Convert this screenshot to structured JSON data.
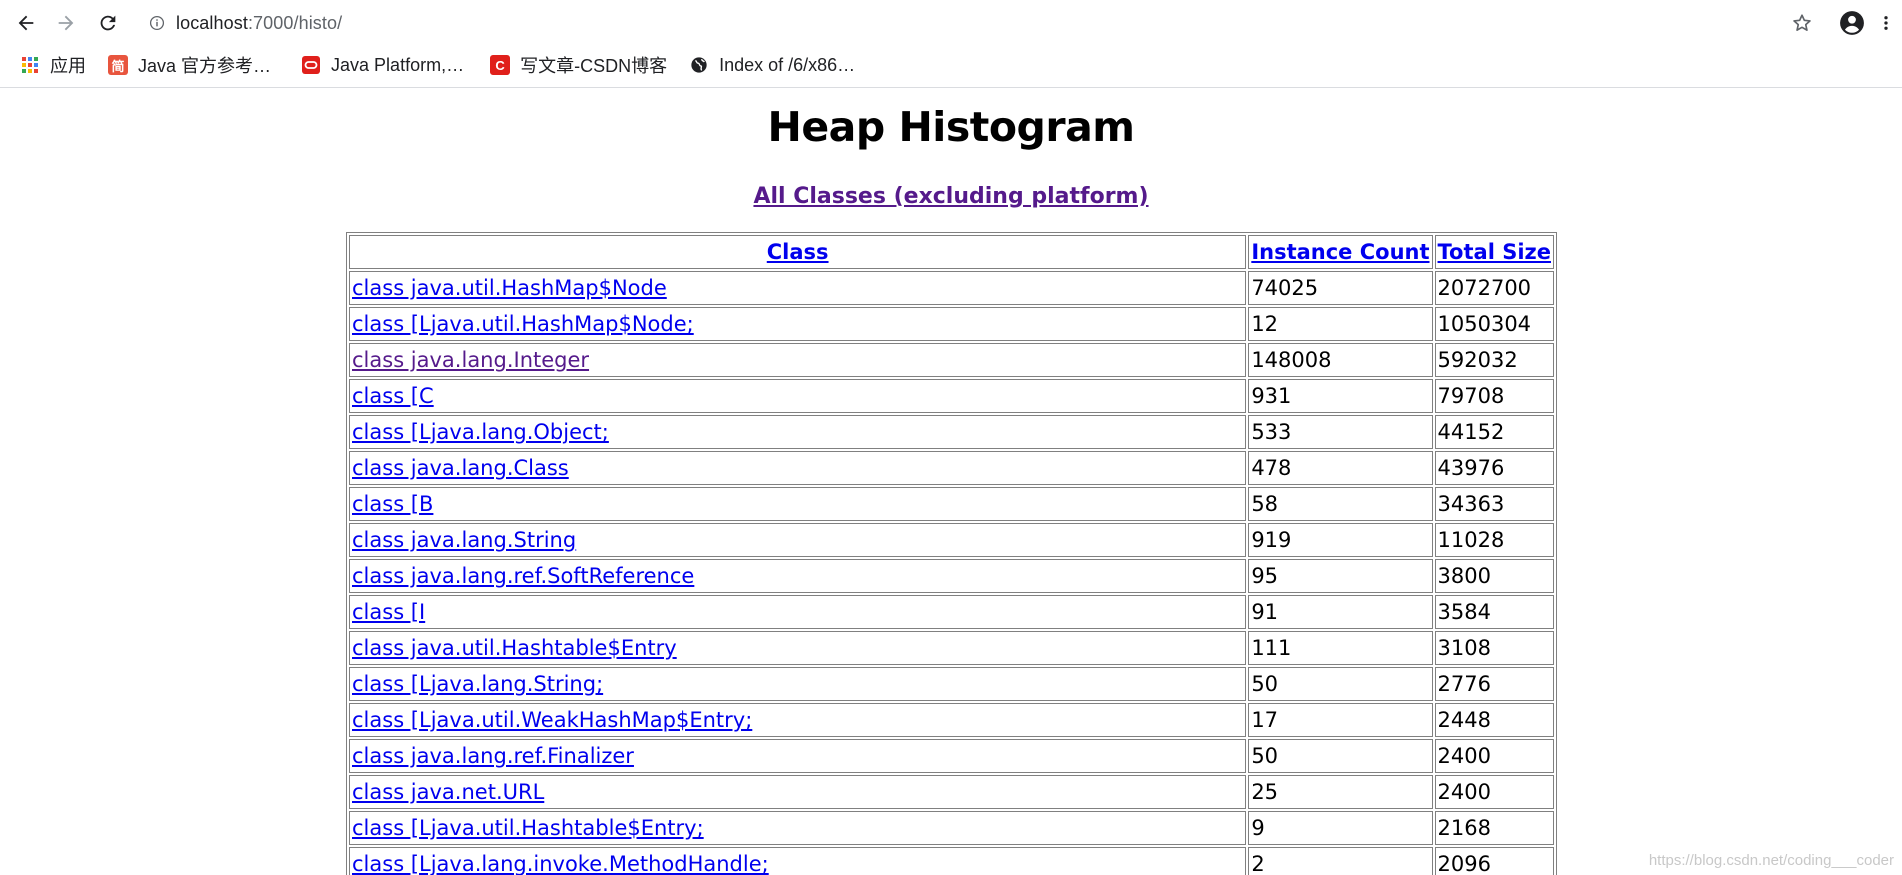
{
  "browser": {
    "url_host": "localhost",
    "url_path": ":7000/histo/",
    "bookmarks": [
      {
        "label": "应用",
        "icon": "apps-grid-icon"
      },
      {
        "label": "Java 官方参考…",
        "icon": "jian-favicon-icon",
        "color": "#e8553e",
        "glyph": "简"
      },
      {
        "label": "Java Platform,…",
        "icon": "oracle-favicon-icon",
        "color": "#e0201b"
      },
      {
        "label": "写文章-CSDN博客",
        "icon": "csdn-favicon-icon",
        "color": "#e0201b",
        "glyph": "C"
      },
      {
        "label": "Index of /6/x86…",
        "icon": "globe-icon"
      }
    ]
  },
  "page": {
    "title": "Heap Histogram",
    "all_classes_link": "All Classes (excluding platform)",
    "table": {
      "headers": [
        "Class",
        "Instance Count",
        "Total Size"
      ],
      "rows": [
        {
          "cls": "class java.util.HashMap$Node",
          "count": "74025",
          "size": "2072700"
        },
        {
          "cls": "class [Ljava.util.HashMap$Node;",
          "count": "12",
          "size": "1050304"
        },
        {
          "cls": "class java.lang.Integer",
          "count": "148008",
          "size": "592032",
          "visited": true
        },
        {
          "cls": "class [C",
          "count": "931",
          "size": "79708"
        },
        {
          "cls": "class [Ljava.lang.Object;",
          "count": "533",
          "size": "44152"
        },
        {
          "cls": "class java.lang.Class",
          "count": "478",
          "size": "43976"
        },
        {
          "cls": "class [B",
          "count": "58",
          "size": "34363"
        },
        {
          "cls": "class java.lang.String",
          "count": "919",
          "size": "11028"
        },
        {
          "cls": "class java.lang.ref.SoftReference",
          "count": "95",
          "size": "3800"
        },
        {
          "cls": "class [I",
          "count": "91",
          "size": "3584"
        },
        {
          "cls": "class java.util.Hashtable$Entry",
          "count": "111",
          "size": "3108"
        },
        {
          "cls": "class [Ljava.lang.String;",
          "count": "50",
          "size": "2776"
        },
        {
          "cls": "class [Ljava.util.WeakHashMap$Entry;",
          "count": "17",
          "size": "2448"
        },
        {
          "cls": "class java.lang.ref.Finalizer",
          "count": "50",
          "size": "2400"
        },
        {
          "cls": "class java.net.URL",
          "count": "25",
          "size": "2400"
        },
        {
          "cls": "class [Ljava.util.Hashtable$Entry;",
          "count": "9",
          "size": "2168"
        },
        {
          "cls": "class [Ljava.lang.invoke.MethodHandle;",
          "count": "2",
          "size": "2096"
        }
      ]
    }
  },
  "watermark": "https://blog.csdn.net/coding___coder",
  "colors": {
    "link": "#0000ee",
    "visited_link": "#551a8b",
    "border": "#808080"
  }
}
